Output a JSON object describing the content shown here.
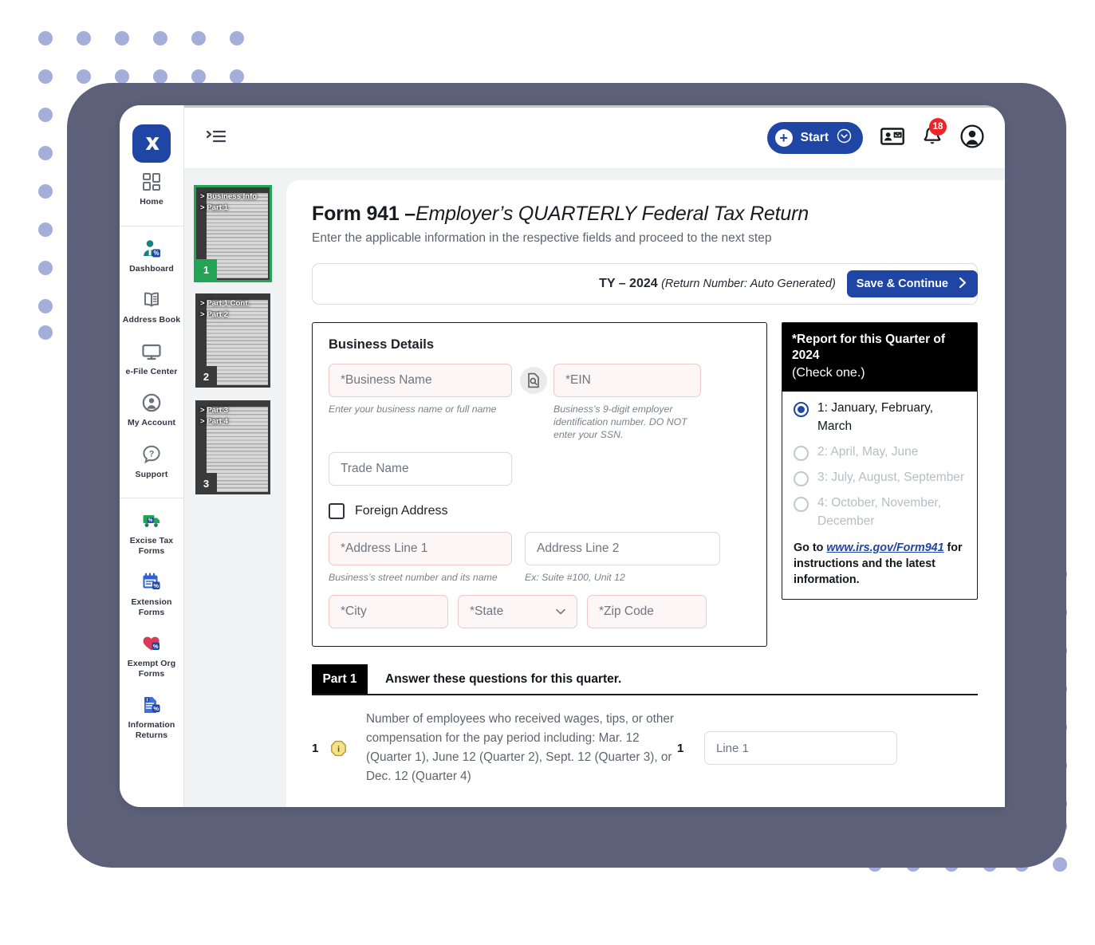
{
  "app": {
    "brand_icon": "x-logo-icon",
    "menu_toggle_icon": "expand-menu-icon"
  },
  "topbar": {
    "start_label": "Start",
    "start_plus_icon": "plus-icon",
    "start_caret_icon": "chevron-down-circle-icon",
    "contact_card_icon": "contact-card-icon",
    "bell_icon": "bell-icon",
    "notification_count": "18",
    "account_icon": "user-account-icon"
  },
  "sidebar": {
    "groups": [
      {
        "items": [
          {
            "label": "Home",
            "icon": "dashboard-grid-icon"
          }
        ]
      },
      {
        "items": [
          {
            "label": "Dashboard",
            "icon": "user-tax-icon"
          },
          {
            "label": "Address Book",
            "icon": "address-book-icon"
          },
          {
            "label": "e-File Center",
            "icon": "monitor-icon"
          },
          {
            "label": "My Account",
            "icon": "user-circle-icon"
          },
          {
            "label": "Support",
            "icon": "question-help-icon"
          }
        ]
      },
      {
        "items": [
          {
            "label": "Excise Tax Forms",
            "icon": "truck-tax-icon"
          },
          {
            "label": "Extension Forms",
            "icon": "calendar-tax-icon"
          },
          {
            "label": "Exempt Org Forms",
            "icon": "heart-tax-icon"
          },
          {
            "label": "Information Returns",
            "icon": "document-info-tax-icon"
          }
        ]
      }
    ]
  },
  "thumbnails": [
    {
      "number": "1",
      "lines": [
        "> Business Info",
        "> Part 1"
      ],
      "active": true
    },
    {
      "number": "2",
      "lines": [
        "> Part 1 Cont.",
        "> Part 2"
      ],
      "active": false
    },
    {
      "number": "3",
      "lines": [
        "> Part 3",
        "> Part 4"
      ],
      "active": false
    }
  ],
  "main": {
    "title_bold": "Form 941 –",
    "title_italic": "Employer’s QUARTERLY Federal Tax Return",
    "subtitle": "Enter the applicable information in the respective fields and proceed to the next step",
    "ty_label": "TY – 2024 ",
    "ty_note": "(Return Number: Auto Generated)",
    "save_label": "Save & Continue",
    "save_arrow_icon": "chevron-right-icon"
  },
  "business_details": {
    "heading": "Business Details",
    "business_name_placeholder": "*Business Name",
    "business_name_hint": "Enter your business name or full name",
    "ein_lookup_icon": "document-search-icon",
    "ein_placeholder": "*EIN",
    "ein_hint": "Business’s 9-digit employer identification number. DO NOT enter your SSN.",
    "trade_name_placeholder": "Trade Name",
    "foreign_address_label": "Foreign Address",
    "address1_placeholder": "*Address Line 1",
    "address1_hint": "Business’s street number and its name",
    "address2_placeholder": "Address Line 2",
    "address2_hint": "Ex: Suite #100, Unit 12",
    "city_placeholder": "*City",
    "state_placeholder": "*State",
    "state_caret_icon": "dropdown-caret-icon",
    "zip_placeholder": "*Zip Code"
  },
  "quarter_panel": {
    "heading_line1": "*Report for this Quarter of 2024",
    "heading_line2": "(Check one.)",
    "options": [
      {
        "label": "1: January, February, March",
        "selected": true
      },
      {
        "label": "2: April, May, June",
        "selected": false
      },
      {
        "label": "3: July, August, September",
        "selected": false
      },
      {
        "label": "4: October, November, December",
        "selected": false
      }
    ],
    "note_prefix": "Go to ",
    "note_link": "www.irs.gov/Form941",
    "note_suffix": " for instructions and the latest information."
  },
  "part1": {
    "tag": "Part 1",
    "title": "Answer these questions for this quarter.",
    "rows": [
      {
        "number": "1",
        "info_icon": "info-icon",
        "text": "Number of employees who received wages, tips, or other compensation for the pay period including: Mar. 12 (Quarter 1), June 12 (Quarter 2), Sept. 12 (Quarter 3), or Dec. 12 (Quarter 4)",
        "line_number": "1",
        "input_placeholder": "Line 1"
      }
    ]
  },
  "colors": {
    "brand_blue": "#1f45a5",
    "frame_gray": "#5c6179",
    "dot_blue": "#93a1d4",
    "active_green": "#23a455",
    "badge_red": "#e8262b"
  }
}
